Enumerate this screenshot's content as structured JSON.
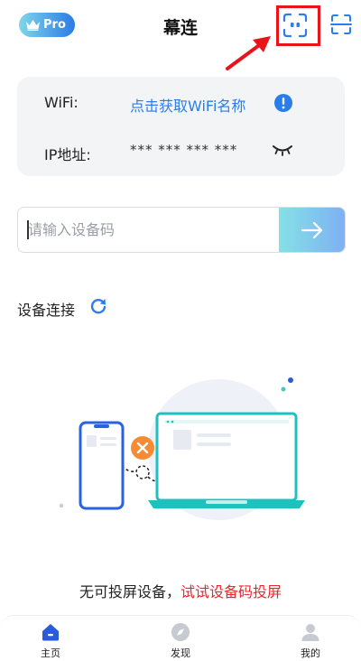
{
  "header": {
    "pro_label": "Pro",
    "title": "幕连"
  },
  "wifi_card": {
    "wifi_label": "WiFi:",
    "wifi_value": "点击获取WiFi名称",
    "ip_label": "IP地址:",
    "ip_value": "*** *** *** ***"
  },
  "code_input": {
    "placeholder": "请输入设备码",
    "value": ""
  },
  "section": {
    "title": "设备连接"
  },
  "empty_state": {
    "message": "无可投屏设备，",
    "link": "试试设备码投屏"
  },
  "bottom_nav": {
    "items": [
      {
        "label": "主页",
        "icon": "home-icon",
        "active": true
      },
      {
        "label": "发现",
        "icon": "compass-icon",
        "active": false
      },
      {
        "label": "我的",
        "icon": "user-icon",
        "active": false
      }
    ]
  },
  "colors": {
    "accent": "#2b7de9",
    "link_red": "#e8262d",
    "highlight_red": "#e8141c",
    "card_bg": "#f3f4f6"
  }
}
